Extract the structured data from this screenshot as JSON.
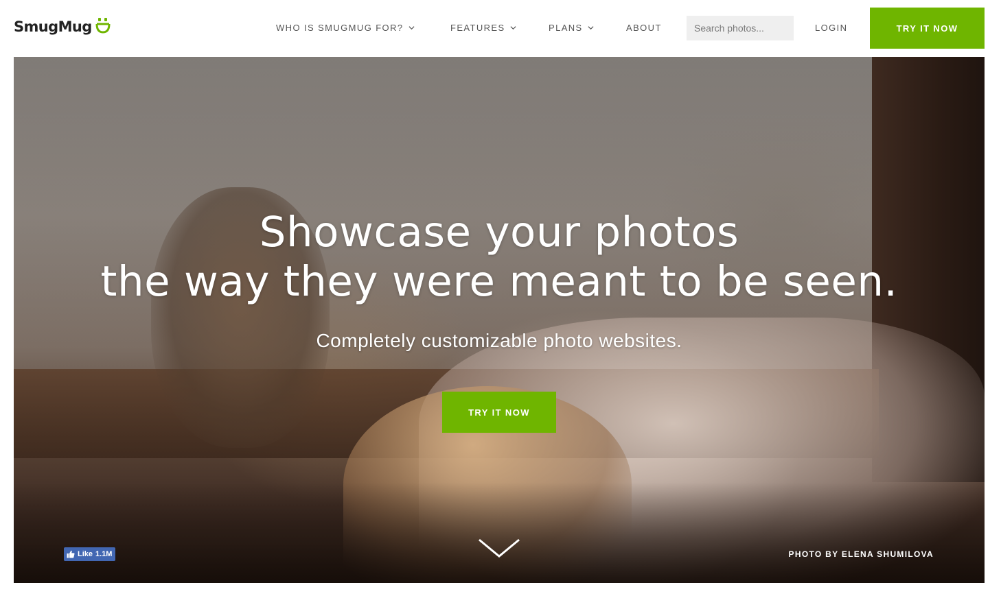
{
  "brand": {
    "name": "SmugMug",
    "accent": "#6fb500"
  },
  "nav": {
    "items": [
      {
        "label": "WHO IS SMUGMUG FOR?",
        "has_dropdown": true
      },
      {
        "label": "FEATURES",
        "has_dropdown": true
      },
      {
        "label": "PLANS",
        "has_dropdown": true
      },
      {
        "label": "ABOUT",
        "has_dropdown": false
      }
    ],
    "search_placeholder": "Search photos...",
    "login_label": "LOGIN",
    "cta_label": "TRY IT NOW"
  },
  "hero": {
    "headline_line1": "Showcase your photos",
    "headline_line2": "the way they were meant to be seen.",
    "subheadline": "Completely customizable photo websites.",
    "cta_label": "TRY IT NOW",
    "scroll_icon": "chevron-down-icon",
    "photo_credit": "PHOTO BY ELENA SHUMILOVA",
    "fb_like": {
      "label": "Like",
      "count": "1.1M"
    }
  }
}
